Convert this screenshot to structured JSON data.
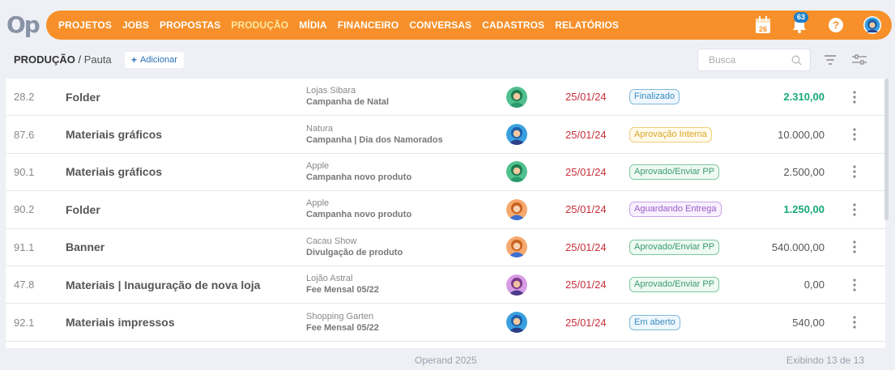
{
  "brand": {
    "logo": "Op"
  },
  "nav": {
    "items": [
      {
        "label": "PROJETOS",
        "active": false
      },
      {
        "label": "JOBS",
        "active": false
      },
      {
        "label": "PROPOSTAS",
        "active": false
      },
      {
        "label": "PRODUÇÃO",
        "active": true
      },
      {
        "label": "MÍDIA",
        "active": false
      },
      {
        "label": "FINANCEIRO",
        "active": false
      },
      {
        "label": "CONVERSAS",
        "active": false
      },
      {
        "label": "CADASTROS",
        "active": false
      },
      {
        "label": "RELATÓRIOS",
        "active": false
      }
    ],
    "calendar_day": "26",
    "notifications_count": "63",
    "help_label": "?"
  },
  "header": {
    "section": "PRODUÇÃO",
    "separator": " / ",
    "page": "Pauta",
    "add_label": "Adicionar",
    "add_icon": "+",
    "search_placeholder": "Busca"
  },
  "colors": {
    "accent": "#f7902a",
    "active_nav": "#ffe9a0",
    "date_red": "#c8303a",
    "value_green": "#17a87a"
  },
  "rows": [
    {
      "code": "28.2",
      "title": "Folder",
      "client": "Lojas Sibara",
      "campaign": "Campanha de Natal",
      "avatar": "green",
      "date": "25/01/24",
      "status": "Finalizado",
      "status_class": "st-blue",
      "value": "2.310,00",
      "positive": true
    },
    {
      "code": "87.6",
      "title": "Materiais gráficos",
      "client": "Natura",
      "campaign": "Campanha | Dia dos Namorados",
      "avatar": "blue",
      "date": "25/01/24",
      "status": "Aprovação Interna",
      "status_class": "st-yellow",
      "value": "10.000,00",
      "positive": false
    },
    {
      "code": "90.1",
      "title": "Materiais gráficos",
      "client": "Apple",
      "campaign": "Campanha novo produto",
      "avatar": "green",
      "date": "25/01/24",
      "status": "Aprovado/Enviar PP",
      "status_class": "st-green",
      "value": "2.500,00",
      "positive": false
    },
    {
      "code": "90.2",
      "title": "Folder",
      "client": "Apple",
      "campaign": "Campanha novo produto",
      "avatar": "orange",
      "date": "25/01/24",
      "status": "Aguardando Entrega",
      "status_class": "st-purple",
      "value": "1.250,00",
      "positive": true
    },
    {
      "code": "91.1",
      "title": "Banner",
      "client": "Cacau Show",
      "campaign": "Divulgação de produto",
      "avatar": "orange",
      "date": "25/01/24",
      "status": "Aprovado/Enviar PP",
      "status_class": "st-green",
      "value": "540.000,00",
      "positive": false
    },
    {
      "code": "47.8",
      "title": "Materiais | Inauguração de nova loja",
      "client": "Lojão Astral",
      "campaign": "Fee Mensal 05/22",
      "avatar": "purple",
      "date": "25/01/24",
      "status": "Aprovado/Enviar PP",
      "status_class": "st-green",
      "value": "0,00",
      "positive": false
    },
    {
      "code": "92.1",
      "title": "Materiais impressos",
      "client": "Shopping Garten",
      "campaign": "Fee Mensal 05/22",
      "avatar": "blue",
      "date": "25/01/24",
      "status": "Em aberto",
      "status_class": "st-blue",
      "value": "540,00",
      "positive": false
    }
  ],
  "footer": {
    "copyright": "Operand 2025",
    "count": "Exibindo 13 de 13"
  }
}
